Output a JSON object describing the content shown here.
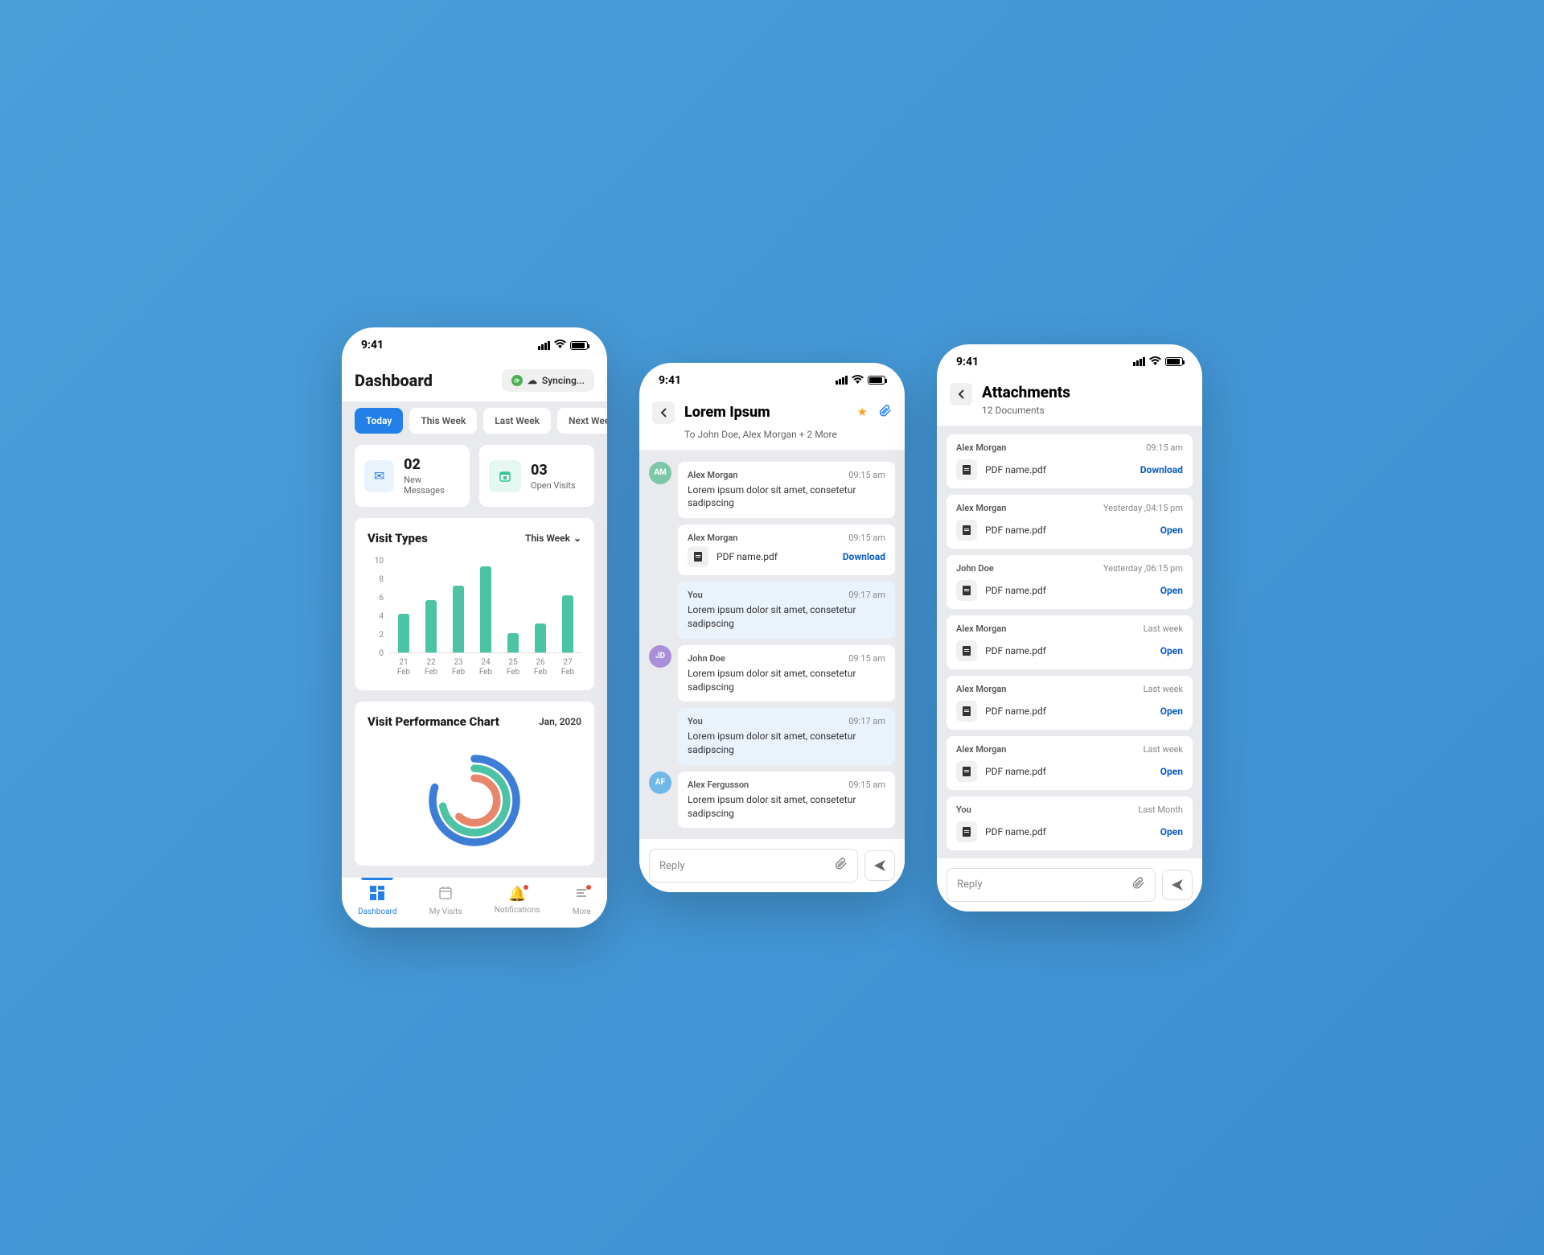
{
  "status_bar": {
    "time": "9:41"
  },
  "phone1": {
    "title": "Dashboard",
    "sync_label": "Syncing...",
    "tabs": [
      "Today",
      "This Week",
      "Last Week",
      "Next Week"
    ],
    "stats": [
      {
        "num": "02",
        "label": "New Messages"
      },
      {
        "num": "03",
        "label": "Open Visits"
      }
    ],
    "chart1": {
      "title": "Visit Types",
      "dropdown": "This Week"
    },
    "chart2": {
      "title": "Visit Performance Chart",
      "date": "Jan, 2020"
    },
    "nav": [
      "Dashboard",
      "My Visits",
      "Notifications",
      "More"
    ]
  },
  "phone2": {
    "title": "Lorem Ipsum",
    "subtitle": "To John Doe, Alex Morgan + 2 More",
    "messages": [
      {
        "type": "other",
        "avatar": "AM",
        "color": "#7cc7a8",
        "sender": "Alex Morgan",
        "time": "09:15 am",
        "text": "Lorem ipsum dolor sit amet, consetetur sadipscing"
      },
      {
        "type": "attach",
        "sender": "Alex Morgan",
        "time": "09:15 am",
        "file": "PDF name.pdf",
        "action": "Download"
      },
      {
        "type": "self",
        "sender": "You",
        "time": "09:17 am",
        "text": "Lorem ipsum dolor sit amet, consetetur sadipscing"
      },
      {
        "type": "other",
        "avatar": "JD",
        "color": "#a88fd8",
        "sender": "John Doe",
        "time": "09:15 am",
        "text": "Lorem ipsum dolor sit amet, consetetur sadipscing"
      },
      {
        "type": "self",
        "sender": "You",
        "time": "09:17 am",
        "text": "Lorem ipsum dolor sit amet, consetetur sadipscing"
      },
      {
        "type": "other",
        "avatar": "AF",
        "color": "#6fb8e8",
        "sender": "Alex Fergusson",
        "time": "09:15 am",
        "text": "Lorem ipsum dolor sit amet, consetetur sadipscing"
      }
    ],
    "reply_placeholder": "Reply"
  },
  "phone3": {
    "title": "Attachments",
    "subtitle": "12 Documents",
    "docs": [
      {
        "sender": "Alex Morgan",
        "time": "09:15 am",
        "file": "PDF name.pdf",
        "action": "Download"
      },
      {
        "sender": "Alex Morgan",
        "time": "Yesterday ,04:15 pm",
        "file": "PDF name.pdf",
        "action": "Open"
      },
      {
        "sender": "John Doe",
        "time": "Yesterday ,06:15 pm",
        "file": "PDF name.pdf",
        "action": "Open"
      },
      {
        "sender": "Alex Morgan",
        "time": "Last week",
        "file": "PDF name.pdf",
        "action": "Open"
      },
      {
        "sender": "Alex Morgan",
        "time": "Last week",
        "file": "PDF name.pdf",
        "action": "Open"
      },
      {
        "sender": "Alex Morgan",
        "time": "Last week",
        "file": "PDF name.pdf",
        "action": "Open"
      },
      {
        "sender": "You",
        "time": "Last Month",
        "file": "PDF name.pdf",
        "action": "Open"
      }
    ],
    "reply_placeholder": "Reply"
  },
  "chart_data": [
    {
      "type": "bar",
      "title": "Visit Types",
      "categories": [
        "21 Feb",
        "22 Feb",
        "23 Feb",
        "24 Feb",
        "25 Feb",
        "26 Feb",
        "27 Feb"
      ],
      "values": [
        4,
        5.5,
        7,
        9,
        2,
        3,
        6
      ],
      "ylim": [
        0,
        10
      ],
      "yticks": [
        0,
        2,
        4,
        6,
        8,
        10
      ],
      "xlabel": "",
      "ylabel": ""
    },
    {
      "type": "donut",
      "title": "Visit Performance Chart",
      "subtitle": "Jan, 2020",
      "series": [
        {
          "name": "ring1",
          "color": "#3d7dd8",
          "value": 80
        },
        {
          "name": "ring2",
          "color": "#4cc3a5",
          "value": 72
        },
        {
          "name": "ring3",
          "color": "#e8866b",
          "value": 62
        }
      ]
    }
  ]
}
